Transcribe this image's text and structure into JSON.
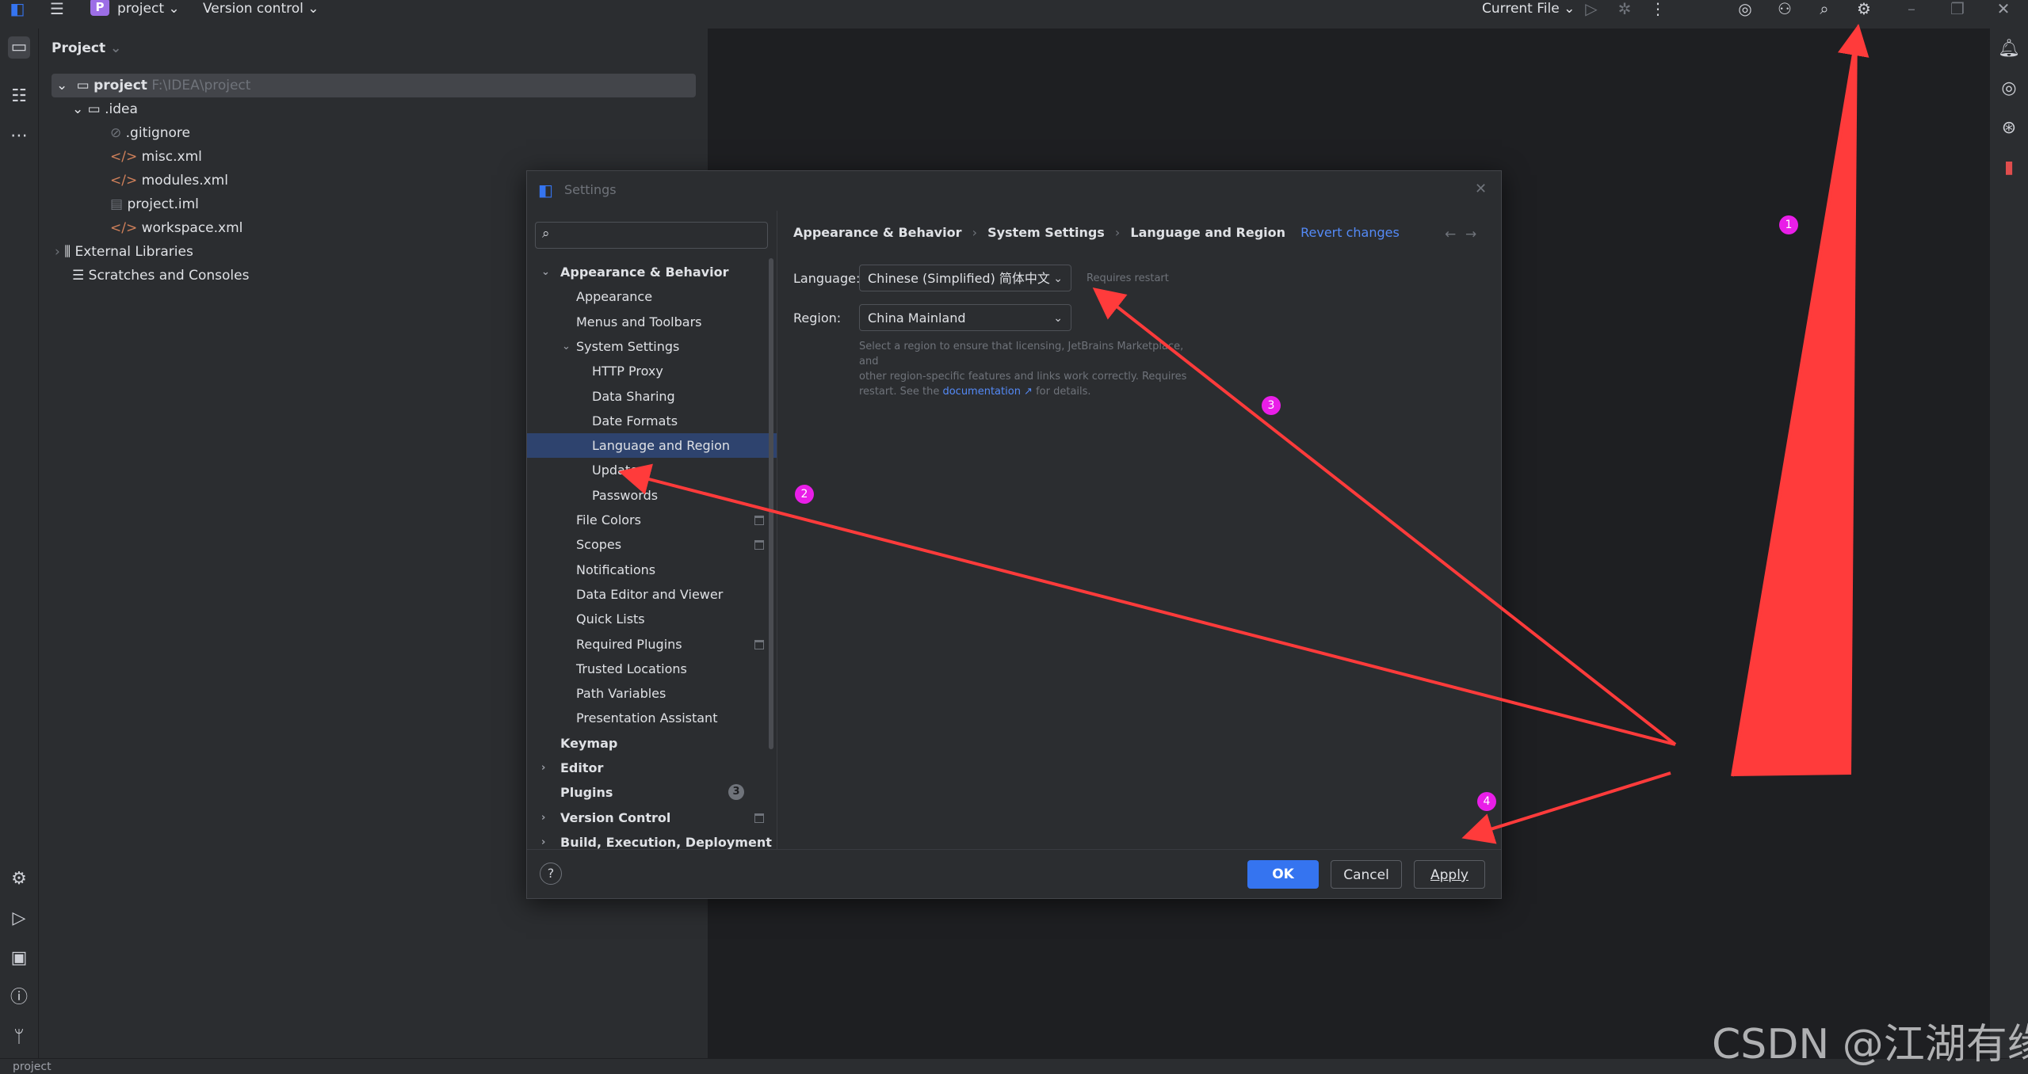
{
  "titlebar": {
    "project_badge": "P",
    "project_name": "project",
    "version_control": "Version control",
    "current_file": "Current File"
  },
  "project_panel": {
    "header": "Project",
    "tree": [
      {
        "label": "project",
        "path": "F:\\IDEA\\project"
      },
      {
        "label": ".idea"
      },
      {
        "label": ".gitignore"
      },
      {
        "label": "misc.xml"
      },
      {
        "label": "modules.xml"
      },
      {
        "label": "project.iml"
      },
      {
        "label": "workspace.xml"
      },
      {
        "label": "External Libraries"
      },
      {
        "label": "Scratches and Consoles"
      }
    ]
  },
  "dialog": {
    "title": "Settings",
    "search_placeholder": "",
    "nav": [
      {
        "label": "Appearance & Behavior"
      },
      {
        "label": "Appearance"
      },
      {
        "label": "Menus and Toolbars"
      },
      {
        "label": "System Settings"
      },
      {
        "label": "HTTP Proxy"
      },
      {
        "label": "Data Sharing"
      },
      {
        "label": "Date Formats"
      },
      {
        "label": "Language and Region"
      },
      {
        "label": "Updates"
      },
      {
        "label": "Passwords"
      },
      {
        "label": "File Colors"
      },
      {
        "label": "Scopes"
      },
      {
        "label": "Notifications"
      },
      {
        "label": "Data Editor and Viewer"
      },
      {
        "label": "Quick Lists"
      },
      {
        "label": "Required Plugins"
      },
      {
        "label": "Trusted Locations"
      },
      {
        "label": "Path Variables"
      },
      {
        "label": "Presentation Assistant"
      },
      {
        "label": "Keymap"
      },
      {
        "label": "Editor"
      },
      {
        "label": "Plugins",
        "badge": "3"
      },
      {
        "label": "Version Control"
      },
      {
        "label": "Build, Execution, Deployment"
      }
    ],
    "breadcrumb": [
      "Appearance & Behavior",
      "System Settings",
      "Language and Region"
    ],
    "breadcrumb_sep": "›",
    "revert": "Revert changes",
    "language_label": "Language:",
    "language_value": "Chinese (Simplified) 简体中文",
    "requires_restart": "Requires restart",
    "region_label": "Region:",
    "region_value": "China Mainland",
    "region_help_1": "Select a region to ensure that licensing, JetBrains Marketplace, and",
    "region_help_2": "other region-specific features and links work correctly. Requires",
    "region_help_3": "restart. See the",
    "region_help_link": "documentation ↗",
    "region_help_4": "for details.",
    "help": "?",
    "ok": "OK",
    "cancel": "Cancel",
    "apply": "Apply"
  },
  "callouts": [
    "1",
    "2",
    "3",
    "4"
  ],
  "watermark": "CSDN @江湖有缘",
  "statusbar": {
    "text": "project"
  },
  "colors": {
    "accent": "#3574f0",
    "selection": "#2e436e",
    "arrow": "#ff3b3b",
    "callout": "#e91ee8"
  }
}
